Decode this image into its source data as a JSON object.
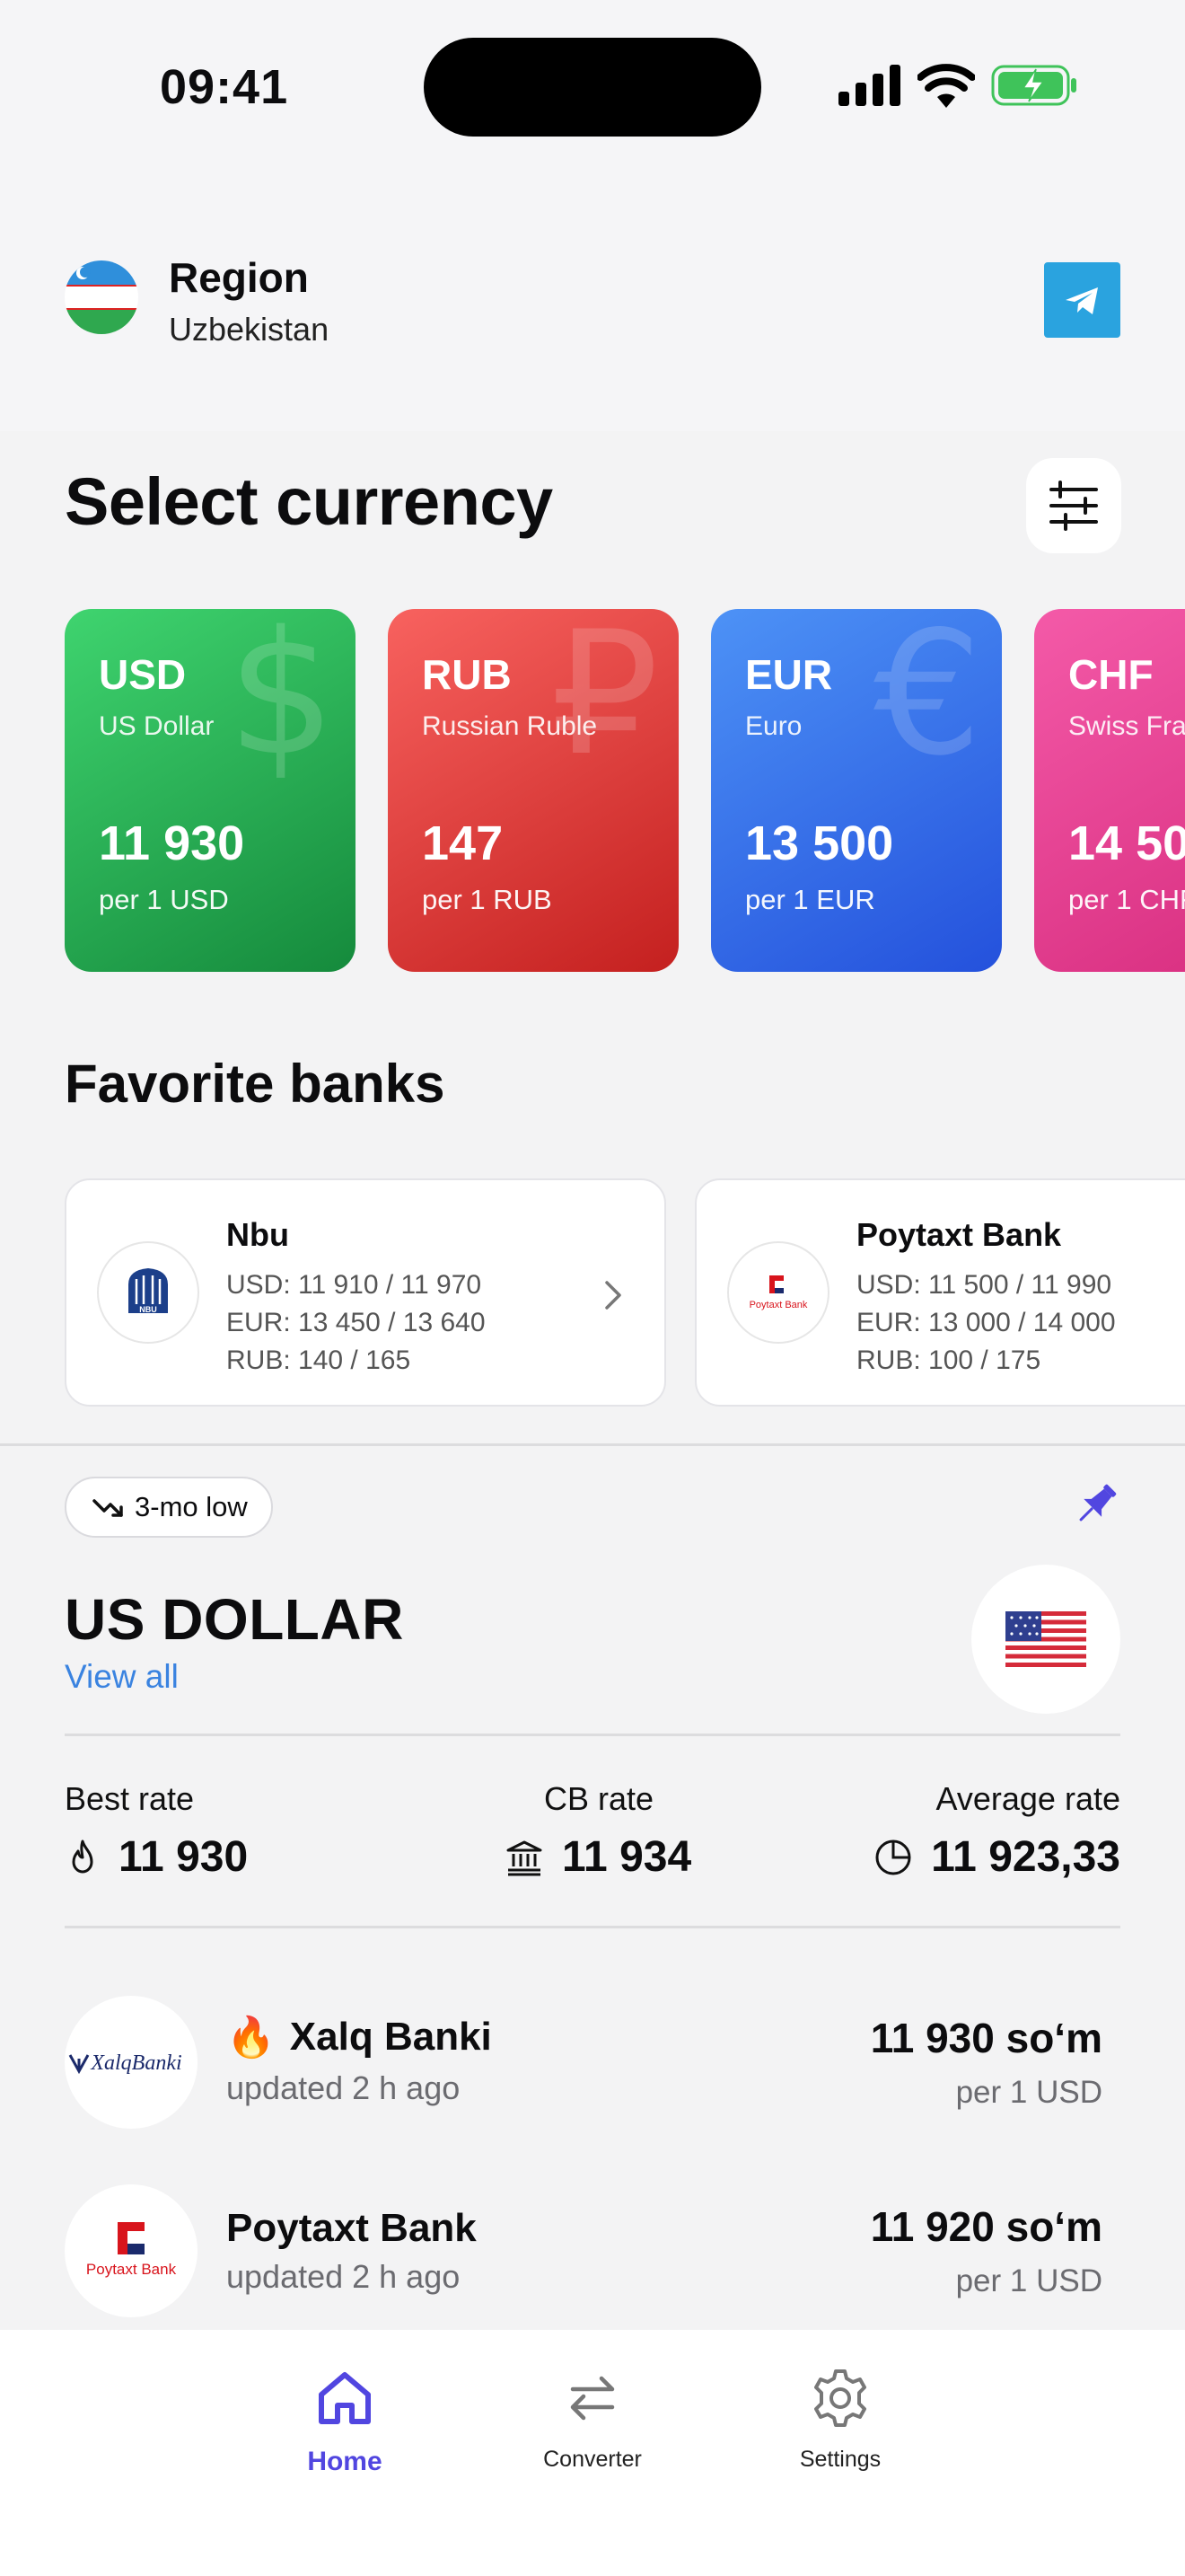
{
  "status_bar": {
    "time": "09:41"
  },
  "header": {
    "region_label": "Region",
    "region_value": "Uzbekistan"
  },
  "main_title": "Select currency",
  "currencies": [
    {
      "code": "USD",
      "name": "US Dollar",
      "rate": "11 930",
      "per": "per 1 USD",
      "symbol": "$",
      "color_from": "#3fd46f",
      "color_to": "#158a3c"
    },
    {
      "code": "RUB",
      "name": "Russian Ruble",
      "rate": "147",
      "per": "per 1 RUB",
      "symbol": "₽",
      "color_from": "#f8625f",
      "color_to": "#c4201f"
    },
    {
      "code": "EUR",
      "name": "Euro",
      "rate": "13 500",
      "per": "per 1 EUR",
      "symbol": "€",
      "color_from": "#4d92f6",
      "color_to": "#2451dc"
    },
    {
      "code": "CHF",
      "name": "Swiss Franc",
      "rate": "14 500",
      "per": "per 1 CHF",
      "symbol": "₣",
      "color_from": "#f45aa8",
      "color_to": "#d62b7d"
    }
  ],
  "favorites_title": "Favorite banks",
  "favorite_banks": [
    {
      "name": "Nbu",
      "usd": "USD: 11 910 / 11 970",
      "eur": "EUR: 13 450 / 13 640",
      "rub": "RUB: 140 / 165",
      "logo_text": "NBU"
    },
    {
      "name": "Poytaxt Bank",
      "usd": "USD: 11 500 / 11 990",
      "eur": "EUR: 13 000 / 14 000",
      "rub": "RUB: 100 / 175",
      "logo_text": "Poytaxt Bank"
    }
  ],
  "usd_section": {
    "badge": "3-mo low",
    "title": "US DOLLAR",
    "view_all": "View all",
    "flag": "🇺🇸",
    "best_label": "Best rate",
    "best_value": "11 930",
    "cb_label": "CB rate",
    "cb_value": "11 934",
    "avg_label": "Average rate",
    "avg_value": "11 923,33",
    "banks": [
      {
        "emoji": "🔥",
        "name": "Xalq Banki",
        "updated": "updated 2 h ago",
        "amount": "11 930 so‘m",
        "per": "per 1 USD",
        "logo_text": "XalqBanki"
      },
      {
        "name": "Poytaxt Bank",
        "updated": "updated 2 h ago",
        "amount": "11 920 so‘m",
        "per": "per 1 USD",
        "logo_text": "Poytaxt Bank"
      }
    ]
  },
  "tabbar": {
    "home": "Home",
    "converter": "Converter",
    "settings": "Settings"
  },
  "colors": {
    "accent": "#5146e0",
    "link": "#3a83e0",
    "telegram": "#2aa3df"
  }
}
